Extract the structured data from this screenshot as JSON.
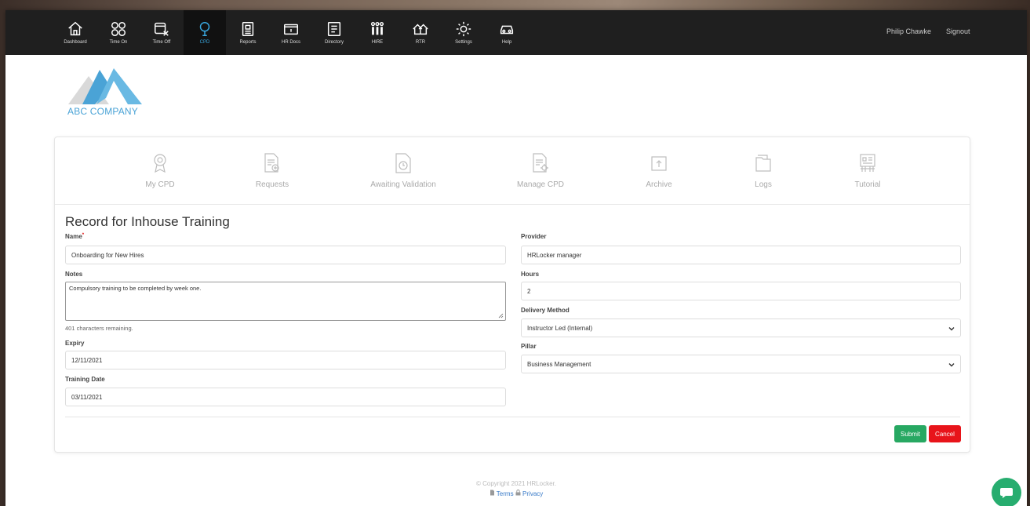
{
  "nav": {
    "items": [
      {
        "label": "Dashboard",
        "icon": "home-icon"
      },
      {
        "label": "Time On",
        "icon": "time-on-icon"
      },
      {
        "label": "Time Off",
        "icon": "time-off-icon"
      },
      {
        "label": "CPD",
        "icon": "cpd-icon"
      },
      {
        "label": "Reports",
        "icon": "reports-icon"
      },
      {
        "label": "HR Docs",
        "icon": "hr-docs-icon"
      },
      {
        "label": "Directory",
        "icon": "directory-icon"
      },
      {
        "label": "HIRE",
        "icon": "hire-icon"
      },
      {
        "label": "RTR",
        "icon": "rtr-icon"
      },
      {
        "label": "Settings",
        "icon": "gear-icon"
      },
      {
        "label": "Help",
        "icon": "help-icon"
      }
    ],
    "active": "CPD",
    "user": "Philip Chawke",
    "signout": "Signout",
    "accent": "#39a8e0"
  },
  "logo": {
    "text": "ABC COMPANY"
  },
  "subnav": {
    "items": [
      {
        "label": "My CPD",
        "icon": "award-icon"
      },
      {
        "label": "Requests",
        "icon": "document-add-icon"
      },
      {
        "label": "Awaiting Validation",
        "icon": "document-clock-icon"
      },
      {
        "label": "Manage CPD",
        "icon": "document-settings-icon"
      },
      {
        "label": "Archive",
        "icon": "archive-icon"
      },
      {
        "label": "Logs",
        "icon": "folder-icon"
      },
      {
        "label": "Tutorial",
        "icon": "tutorial-icon"
      }
    ]
  },
  "form": {
    "title": "Record for Inhouse Training",
    "name_label": "Name",
    "name_required": "*",
    "name_value": "Onboarding for New Hires",
    "notes_label": "Notes",
    "notes_value": "Compulsory training to be completed by week one.",
    "notes_helper": "401 characters remaining.",
    "expiry_label": "Expiry",
    "expiry_value": "12/11/2021",
    "training_date_label": "Training Date",
    "training_date_value": "03/11/2021",
    "provider_label": "Provider",
    "provider_value": "HRLocker manager",
    "hours_label": "Hours",
    "hours_value": "2",
    "delivery_label": "Delivery Method",
    "delivery_value": "Instructor Led (Internal)",
    "pillar_label": "Pillar",
    "pillar_value": "Business Management",
    "submit": "Submit",
    "cancel": "Cancel",
    "submit_color": "#27a862",
    "cancel_color": "#e8141a"
  },
  "footer": {
    "copyright": "© Copyright 2021 HRLocker.",
    "terms": "Terms",
    "privacy": "Privacy"
  }
}
